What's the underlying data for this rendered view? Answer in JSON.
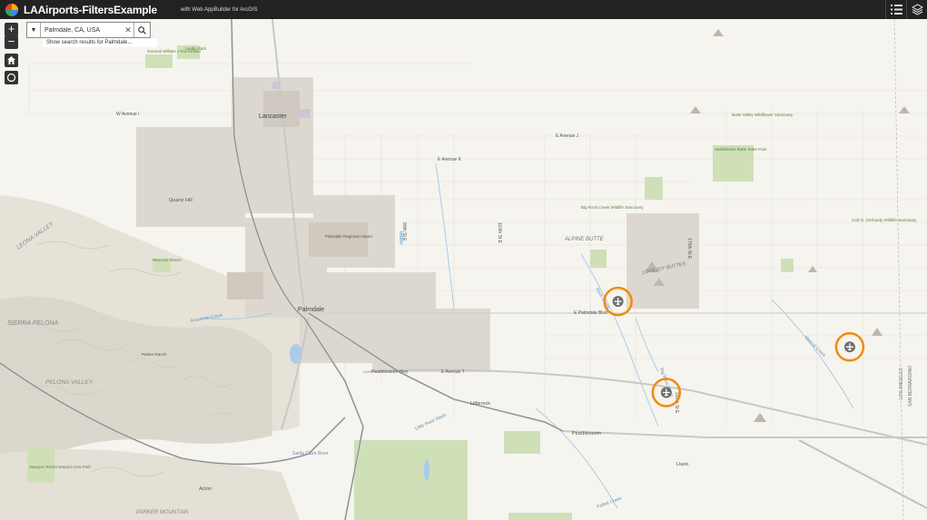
{
  "header": {
    "title": "LAAirports-FiltersExample",
    "subtitle": "with Web AppBuilder for ArcGIS",
    "icons": [
      "list-icon",
      "layers-icon"
    ]
  },
  "controls": {
    "zoom_in": "+",
    "zoom_out": "−",
    "icons": [
      "home-icon",
      "locate-icon"
    ]
  },
  "search": {
    "value": "Palmdale, CA, USA",
    "hint": "Show search results for Palmdale..."
  },
  "map": {
    "places": {
      "lancaster": "Lancaster",
      "palmdale": "Palmdale",
      "quartz_hill": "Quartz Hill",
      "littlerock": "Littlerock",
      "pearblossom": "Pearblossom",
      "llano": "Llano",
      "acton": "Acton",
      "alpine_butte": "ALPINE BUTTE",
      "lovejoy_buttes": "LOVEJOY BUTTES",
      "leona_valley": "LEONA VALLEY",
      "sierra_pelona": "SIERRA PELONA",
      "pelona_valley": "PELONA VALLEY",
      "parker_mountain": "PARKER MOUNTAIN",
      "palmdale_airport": "Palmdale Regional Airport",
      "general_wildlife": "General William J Fox Airfield",
      "apollo_park": "Apollo Park",
      "butte_valley": "Butte Valley Wildflower Sanctuary",
      "saddleback": "Saddleback Butte State Park",
      "big_rock": "Big Rock Creek Wildlife Sanctuary",
      "carl_o": "Carl O. Gerhardy Wildlife Sanctuary",
      "vasquez": "Vasquez Rocks Natural Area Park",
      "warnock": "Warnock Ranch",
      "parker_ranch": "Parker Ranch",
      "county_la": "LOS ANGELES",
      "county_sb": "SAN BERNARDINO"
    },
    "roads": {
      "w_ave_i": "W Avenue I",
      "e_ave_j": "E Avenue J",
      "e_ave_k": "E Avenue K",
      "e_palmdale_blvd": "E Palmdale Blvd",
      "e_ave_t": "E Avenue T",
      "pearblossom_hwy": "Pearblossom Hwy",
      "st_170": "170th St E",
      "st_110": "110th St E",
      "st_90": "90th St E",
      "st_50": "50th St E",
      "st_150": "150th St E",
      "sierra_hwy": "Sierra Hwy",
      "anaverde": "Anaverde Creek",
      "santa_clara": "Santa Clara River",
      "little_rock": "Little Rock Wash",
      "big_rock_wash": "Big Rock Wash",
      "mescal": "Mescal Creek",
      "pallett": "Pallett Creek",
      "rock_creek": "Rock Creek"
    },
    "airports": [
      {
        "name": "airport-marker-1",
        "lon": -117.88,
        "lat": 34.59
      },
      {
        "name": "airport-marker-2",
        "lon": -117.64,
        "lat": 34.54
      },
      {
        "name": "airport-marker-3",
        "lon": -117.83,
        "lat": 34.49
      }
    ],
    "colors": {
      "background": "#f6f4ef",
      "urban": "#ddd8cf",
      "green": "#cfe0b8",
      "water": "#a9cde8",
      "highway": "#bdbdbd",
      "marker_ring": "#f08a0c",
      "marker_fill": "#6e6e6e"
    }
  }
}
